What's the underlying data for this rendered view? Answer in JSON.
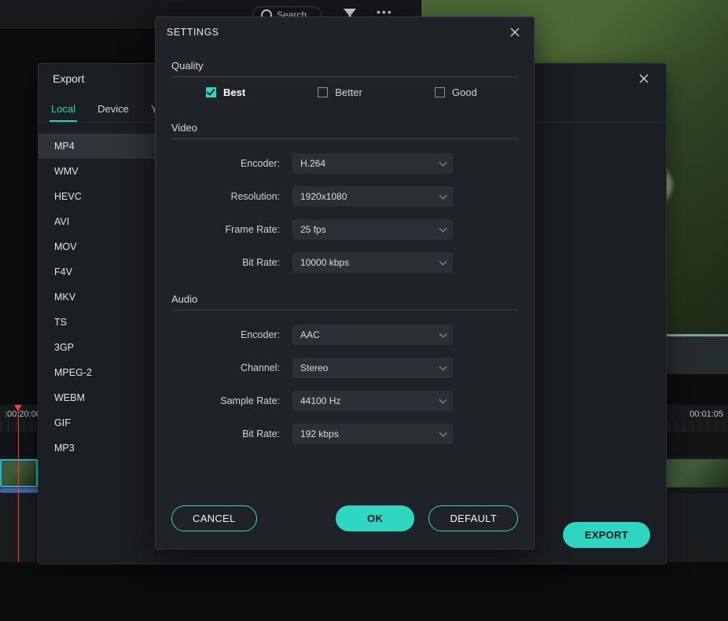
{
  "bg": {
    "search_label": "Search",
    "timeline": {
      "left": ":00:20:00",
      "right": "00:01:05"
    }
  },
  "export": {
    "title": "Export",
    "tabs": [
      "Local",
      "Device",
      "YouTube"
    ],
    "active_tab": 0,
    "formats": [
      "MP4",
      "WMV",
      "HEVC",
      "AVI",
      "MOV",
      "F4V",
      "MKV",
      "TS",
      "3GP",
      "MPEG-2",
      "WEBM",
      "GIF",
      "MP3"
    ],
    "active_format": 0,
    "export_btn": "EXPORT"
  },
  "settings": {
    "title": "SETTINGS",
    "quality": {
      "label": "Quality",
      "options": [
        "Best",
        "Better",
        "Good"
      ],
      "selected": 0
    },
    "video": {
      "label": "Video",
      "encoder": {
        "label": "Encoder:",
        "value": "H.264"
      },
      "resolution": {
        "label": "Resolution:",
        "value": "1920x1080"
      },
      "framerate": {
        "label": "Frame Rate:",
        "value": "25 fps"
      },
      "bitrate": {
        "label": "Bit Rate:",
        "value": "10000 kbps"
      }
    },
    "audio": {
      "label": "Audio",
      "encoder": {
        "label": "Encoder:",
        "value": "AAC"
      },
      "channel": {
        "label": "Channel:",
        "value": "Stereo"
      },
      "samplerate": {
        "label": "Sample Rate:",
        "value": "44100 Hz"
      },
      "bitrate": {
        "label": "Bit Rate:",
        "value": "192 kbps"
      }
    },
    "buttons": {
      "cancel": "CANCEL",
      "ok": "OK",
      "default": "DEFAULT"
    }
  }
}
